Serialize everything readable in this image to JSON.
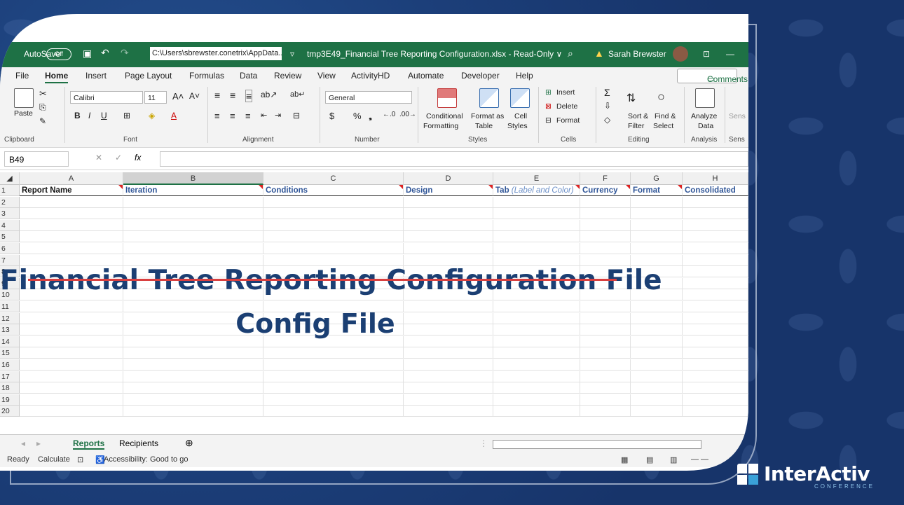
{
  "titlebar": {
    "autosave_label": "AutoSave",
    "autosave_state": "Off",
    "path": "C:\\Users\\sbrewster.conetrix\\AppData...",
    "filename": "tmp3E49_Financial Tree Reporting Configuration.xlsx  -  Read-Only ∨",
    "user": "Sarah Brewster",
    "warning_icon": "warning-icon"
  },
  "menu_tabs": [
    "File",
    "Home",
    "Insert",
    "Page Layout",
    "Formulas",
    "Data",
    "Review",
    "View",
    "ActivityHD",
    "Automate",
    "Developer",
    "Help"
  ],
  "comments_label": "Comments",
  "ribbon": {
    "paste": "Paste",
    "font_name": "Calibri",
    "font_size": "11",
    "number_format": "General",
    "conditional": "Conditional",
    "formatting": "Formatting",
    "format_as": "Format as",
    "table": "Table",
    "cell": "Cell",
    "styles_btn": "Styles",
    "insert": "Insert",
    "delete": "Delete",
    "format": "Format",
    "sort_filter": "Sort &",
    "filter": "Filter",
    "find_select": "Find &",
    "select": "Select",
    "analyze": "Analyze",
    "analyze_data": "Data",
    "sens": "Sens",
    "groups": {
      "clipboard": "Clipboard",
      "font": "Font",
      "alignment": "Alignment",
      "number": "Number",
      "styles": "Styles",
      "cells": "Cells",
      "editing": "Editing",
      "analysis": "Analysis",
      "sens": "Sens"
    }
  },
  "formula_bar": {
    "name_box": "B49",
    "fx": "fx",
    "value": ""
  },
  "columns": [
    "A",
    "B",
    "C",
    "D",
    "E",
    "F",
    "G",
    "H"
  ],
  "header_row": {
    "A": "Report Name",
    "B": "Iteration",
    "C": "Conditions",
    "D": "Design",
    "E_main": "Tab",
    "E_italic": "(Label and Color)",
    "F": "Currency",
    "G": "Format",
    "H": "Consolidated"
  },
  "rows": [
    "1",
    "2",
    "3",
    "4",
    "5",
    "6",
    "7",
    "8",
    "9",
    "10",
    "11",
    "12",
    "13",
    "14",
    "15",
    "16",
    "17",
    "18",
    "19",
    "20"
  ],
  "sheet_tabs": [
    "Reports",
    "Recipients"
  ],
  "add_sheet": "⊕",
  "status": {
    "ready": "Ready",
    "calculate": "Calculate",
    "accessibility": "Accessibility: Good to go"
  },
  "overlay": {
    "struck_title": "Financial Tree Reporting Configuration File",
    "title": "Config File"
  },
  "brand": {
    "name": "InterActiv",
    "sub": "CONFERENCE"
  }
}
